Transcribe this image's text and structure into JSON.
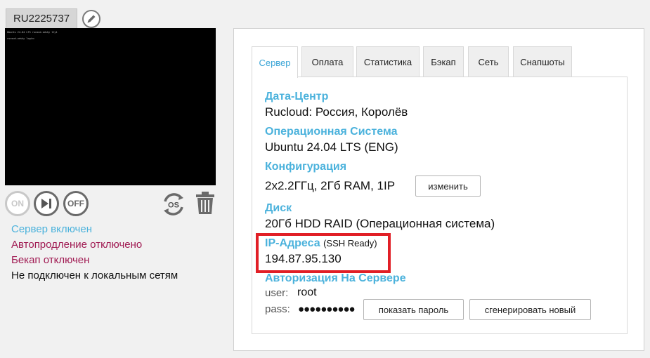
{
  "server": {
    "id": "RU2225737",
    "console_lines": [
      "Ubuntu 24.04 LTS rucoud-odsky tty1",
      "rucoud-odsky login:"
    ]
  },
  "controls": {
    "on_label": "ON",
    "off_label": "OFF",
    "os_label": "OS"
  },
  "status": {
    "server_on": "Сервер включен",
    "autorenew": "Автопродление отключено",
    "backup": "Бекап отключен",
    "local_net": "Не подключен к локальным сетям"
  },
  "tabs": [
    {
      "label": "Сервер",
      "active": true
    },
    {
      "label": "Оплата"
    },
    {
      "label": "Статистика"
    },
    {
      "label": "Бэкап"
    },
    {
      "label": "Сеть"
    },
    {
      "label": "Снапшоты"
    }
  ],
  "details": {
    "datacenter_label": "Дата-Центр",
    "datacenter_value": "Rucloud: Россия, Королёв",
    "os_label": "Операционная Система",
    "os_value": "Ubuntu 24.04 LTS (ENG)",
    "config_label": "Конфигурация",
    "config_value": "2x2.2ГГц, 2Гб RAM, 1IP",
    "config_button": "изменить",
    "disk_label": "Диск",
    "disk_value": "20Гб HDD RAID (Операционная система)",
    "ip_label": "IP-Адреса",
    "ip_note": "(SSH Ready)",
    "ip_value": "194.87.95.130",
    "auth_label": "Авторизация На Сервере",
    "user_label": "user:",
    "user_value": "root",
    "pass_label": "pass:",
    "pass_mask": "●●●●●●●●●●",
    "show_password": "показать пароль",
    "generate_new": "сгенерировать новый"
  },
  "colors": {
    "accent": "#4bb2dc",
    "warning": "#a01a52",
    "highlight": "#e11f26"
  }
}
